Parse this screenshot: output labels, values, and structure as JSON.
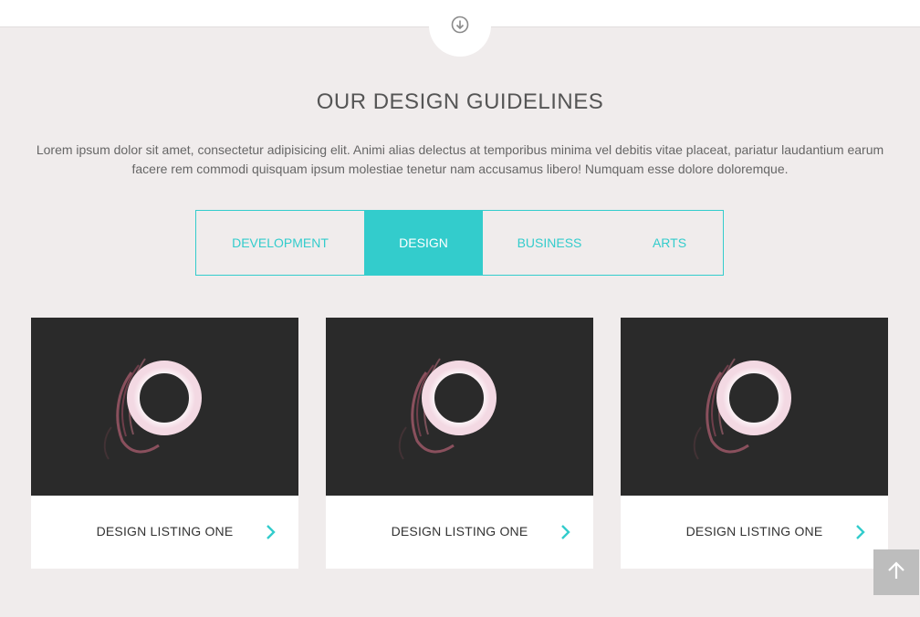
{
  "section": {
    "title": "OUR DESIGN GUIDELINES",
    "description": "Lorem ipsum dolor sit amet, consectetur adipisicing elit. Animi alias delectus at temporibus minima vel debitis vitae placeat, pariatur laudantium earum facere rem commodi quisquam ipsum molestiae tenetur nam accusamus libero! Numquam esse dolore doloremque."
  },
  "tabs": [
    {
      "label": "DEVELOPMENT",
      "active": false
    },
    {
      "label": "DESIGN",
      "active": true
    },
    {
      "label": "BUSINESS",
      "active": false
    },
    {
      "label": "ARTS",
      "active": false
    }
  ],
  "cards": [
    {
      "label": "DESIGN LISTING ONE"
    },
    {
      "label": "DESIGN LISTING ONE"
    },
    {
      "label": "DESIGN LISTING ONE"
    }
  ],
  "icons": {
    "scroll_down": "arrow-down-circle-icon",
    "card_arrow": "chevron-right-icon",
    "back_to_top": "arrow-up-icon"
  },
  "colors": {
    "accent": "#33cccc",
    "background": "#f0ecec",
    "card_image_bg": "#2a2a2a",
    "to_top_bg": "#bdbdbd"
  }
}
